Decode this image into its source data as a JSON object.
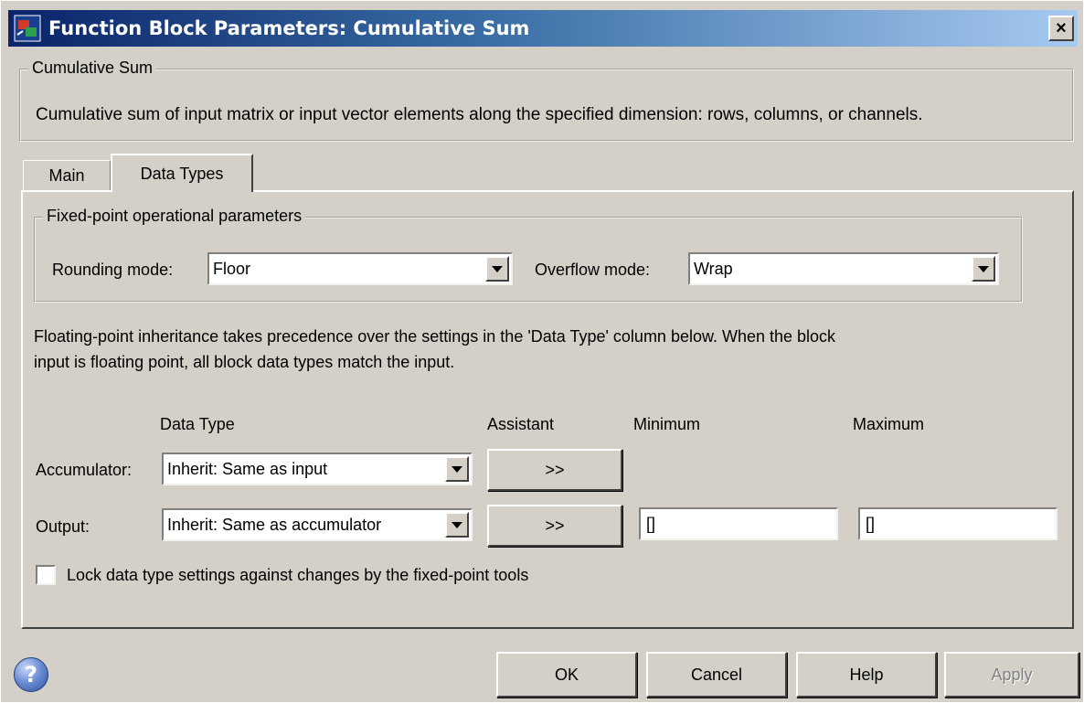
{
  "window": {
    "title": "Function Block Parameters: Cumulative Sum",
    "close_label": "×"
  },
  "block_group": {
    "legend": "Cumulative Sum",
    "description": "Cumulative sum of input matrix or input vector elements along the specified dimension: rows, columns, or channels."
  },
  "tabs": [
    {
      "label": "Main",
      "selected": false
    },
    {
      "label": "Data Types",
      "selected": true
    }
  ],
  "fixed_point": {
    "legend": "Fixed-point operational parameters",
    "rounding_label": "Rounding mode:",
    "rounding_value": "Floor",
    "overflow_label": "Overflow mode:",
    "overflow_value": "Wrap"
  },
  "info": {
    "line1": "Floating-point inheritance takes precedence over the settings in the 'Data Type' column below. When the block",
    "line2": "input is floating point, all block data types match the input."
  },
  "table": {
    "headers": {
      "data_type": "Data Type",
      "assistant": "Assistant",
      "minimum": "Minimum",
      "maximum": "Maximum"
    },
    "rows": [
      {
        "label": "Accumulator:",
        "data_type": "Inherit: Same as input",
        "assistant": ">>"
      },
      {
        "label": "Output:",
        "data_type": "Inherit: Same as accumulator",
        "assistant": ">>",
        "minimum": "[]",
        "maximum": "[]"
      }
    ]
  },
  "lock": {
    "label": "Lock data type settings against changes by the fixed-point tools",
    "checked": false
  },
  "buttons": {
    "ok": "OK",
    "cancel": "Cancel",
    "help": "Help",
    "apply": "Apply"
  },
  "icons": {
    "app": "simulink-block-icon",
    "help": "help-question-icon"
  },
  "colors": {
    "title_start": "#0a246a",
    "title_end": "#a6caf0",
    "face": "#d4d0c8"
  }
}
